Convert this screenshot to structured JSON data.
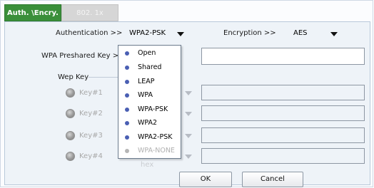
{
  "tabs": [
    {
      "label": "Auth. \\Encry."
    },
    {
      "label": "802. 1x"
    }
  ],
  "authentication": {
    "label": "Authentication >>",
    "value": "WPA2-PSK"
  },
  "encryption": {
    "label": "Encryption >>",
    "value": "AES"
  },
  "wpa_preshared_key": {
    "label": "WPA Preshared Key >>",
    "value": ""
  },
  "wep_key": {
    "group_label": "Wep Key",
    "keys": [
      {
        "label": "Key#1"
      },
      {
        "label": "Key#2"
      },
      {
        "label": "Key#3"
      },
      {
        "label": "Key#4"
      }
    ],
    "hidden_combo_text": "hex"
  },
  "auth_dropdown": {
    "options": [
      {
        "label": "Open",
        "enabled": true
      },
      {
        "label": "Shared",
        "enabled": true
      },
      {
        "label": "LEAP",
        "enabled": true
      },
      {
        "label": "WPA",
        "enabled": true
      },
      {
        "label": "WPA-PSK",
        "enabled": true
      },
      {
        "label": "WPA2",
        "enabled": true
      },
      {
        "label": "WPA2-PSK",
        "enabled": true
      },
      {
        "label": "WPA-NONE",
        "enabled": false
      }
    ]
  },
  "buttons": {
    "ok": "OK",
    "cancel": "Cancel"
  },
  "colors": {
    "active_tab": "#3a8f3a",
    "panel_bg": "#eef3f8",
    "bullet": "#4a5fb3"
  }
}
